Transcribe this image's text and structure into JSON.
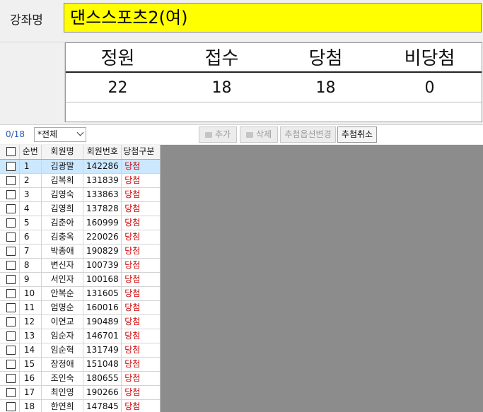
{
  "course": {
    "label": "강좌명",
    "name": "댄스스포츠2(여)"
  },
  "stats": {
    "headers": [
      "정원",
      "접수",
      "당첨",
      "비당첨"
    ],
    "values": [
      "22",
      "18",
      "18",
      "0"
    ]
  },
  "toolbar": {
    "count": "0/18",
    "filter_value": "*전체",
    "add_label": "추가",
    "delete_label": "삭제",
    "options_label": "추첨옵션변경",
    "cancel_label": "추첨취소"
  },
  "grid": {
    "columns": [
      "순번",
      "회원명",
      "회원번호",
      "당첨구분"
    ],
    "rows": [
      {
        "no": "1",
        "name": "김광말",
        "id": "142286",
        "result": "당첨"
      },
      {
        "no": "2",
        "name": "김복희",
        "id": "131839",
        "result": "당첨"
      },
      {
        "no": "3",
        "name": "김영숙",
        "id": "133863",
        "result": "당첨"
      },
      {
        "no": "4",
        "name": "김영희",
        "id": "137828",
        "result": "당첨"
      },
      {
        "no": "5",
        "name": "김춘아",
        "id": "160999",
        "result": "당첨"
      },
      {
        "no": "6",
        "name": "김충옥",
        "id": "220026",
        "result": "당첨"
      },
      {
        "no": "7",
        "name": "박종애",
        "id": "190829",
        "result": "당첨"
      },
      {
        "no": "8",
        "name": "변신자",
        "id": "100739",
        "result": "당첨"
      },
      {
        "no": "9",
        "name": "서인자",
        "id": "100168",
        "result": "당첨"
      },
      {
        "no": "10",
        "name": "안복순",
        "id": "131605",
        "result": "당첨"
      },
      {
        "no": "11",
        "name": "엄명순",
        "id": "160016",
        "result": "당첨"
      },
      {
        "no": "12",
        "name": "이연교",
        "id": "190489",
        "result": "당첨"
      },
      {
        "no": "13",
        "name": "임순자",
        "id": "146701",
        "result": "당첨"
      },
      {
        "no": "14",
        "name": "임순혁",
        "id": "131749",
        "result": "당첨"
      },
      {
        "no": "15",
        "name": "장정애",
        "id": "151048",
        "result": "당첨"
      },
      {
        "no": "16",
        "name": "조인숙",
        "id": "180655",
        "result": "당첨"
      },
      {
        "no": "17",
        "name": "최인영",
        "id": "190266",
        "result": "당첨"
      },
      {
        "no": "18",
        "name": "한연희",
        "id": "147845",
        "result": "당첨"
      }
    ]
  },
  "colors": {
    "course_bg": "#ffff00",
    "result_text": "#d00000",
    "selected_row": "#cce8ff",
    "empty_area": "#8c8c8c"
  }
}
